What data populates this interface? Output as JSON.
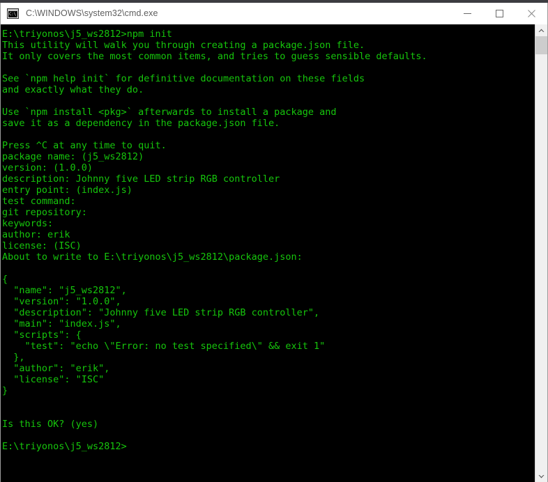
{
  "window": {
    "title": "C:\\WINDOWS\\system32\\cmd.exe",
    "icon": "cmd-console-icon",
    "icon_glyph": "C:\\_",
    "colors": {
      "titlebar_background": "#ffffff",
      "titlebar_text": "#5e5e5e",
      "console_background": "#000000",
      "console_text": "#16c60c",
      "scrollbar_track": "#f0f0f0",
      "scrollbar_thumb": "#cdcdcd",
      "window_border": "#9b9b9b"
    },
    "controls": {
      "minimize_label": "Minimize",
      "maximize_label": "Maximize",
      "close_label": "Close"
    }
  },
  "console": {
    "prompt": "E:\\triyonos\\j5_ws2812>",
    "command": "npm init",
    "content": "E:\\triyonos\\j5_ws2812>npm init\nThis utility will walk you through creating a package.json file.\nIt only covers the most common items, and tries to guess sensible defaults.\n\nSee `npm help init` for definitive documentation on these fields\nand exactly what they do.\n\nUse `npm install <pkg>` afterwards to install a package and\nsave it as a dependency in the package.json file.\n\nPress ^C at any time to quit.\npackage name: (j5_ws2812)\nversion: (1.0.0)\ndescription: Johnny five LED strip RGB controller\nentry point: (index.js)\ntest command:\ngit repository:\nkeywords:\nauthor: erik\nlicense: (ISC)\nAbout to write to E:\\triyonos\\j5_ws2812\\package.json:\n\n{\n  \"name\": \"j5_ws2812\",\n  \"version\": \"1.0.0\",\n  \"description\": \"Johnny five LED strip RGB controller\",\n  \"main\": \"index.js\",\n  \"scripts\": {\n    \"test\": \"echo \\\"Error: no test specified\\\" && exit 1\"\n  },\n  \"author\": \"erik\",\n  \"license\": \"ISC\"\n}\n\n\nIs this OK? (yes)\n\nE:\\triyonos\\j5_ws2812>",
    "lines": [
      "E:\\triyonos\\j5_ws2812>npm init",
      "This utility will walk you through creating a package.json file.",
      "It only covers the most common items, and tries to guess sensible defaults.",
      "",
      "See `npm help init` for definitive documentation on these fields",
      "and exactly what they do.",
      "",
      "Use `npm install <pkg>` afterwards to install a package and",
      "save it as a dependency in the package.json file.",
      "",
      "Press ^C at any time to quit.",
      "package name: (j5_ws2812)",
      "version: (1.0.0)",
      "description: Johnny five LED strip RGB controller",
      "entry point: (index.js)",
      "test command:",
      "git repository:",
      "keywords:",
      "author: erik",
      "license: (ISC)",
      "About to write to E:\\triyonos\\j5_ws2812\\package.json:",
      "",
      "{",
      "  \"name\": \"j5_ws2812\",",
      "  \"version\": \"1.0.0\",",
      "  \"description\": \"Johnny five LED strip RGB controller\",",
      "  \"main\": \"index.js\",",
      "  \"scripts\": {",
      "    \"test\": \"echo \\\"Error: no test specified\\\" && exit 1\"",
      "  },",
      "  \"author\": \"erik\",",
      "  \"license\": \"ISC\"",
      "}",
      "",
      "",
      "Is this OK? (yes)",
      "",
      "E:\\triyonos\\j5_ws2812>"
    ],
    "npm_init_answers": {
      "package_name": "(j5_ws2812)",
      "version": "(1.0.0)",
      "description": "Johnny five LED strip RGB controller",
      "entry_point": "(index.js)",
      "test_command": "",
      "git_repository": "",
      "keywords": "",
      "author": "erik",
      "license": "(ISC)",
      "confirm": "(yes)"
    }
  },
  "scrollbar": {
    "up_arrow": "scroll-up-icon",
    "down_arrow": "scroll-down-icon",
    "thumb_position_percent": 0,
    "thumb_size_percent": 4
  }
}
